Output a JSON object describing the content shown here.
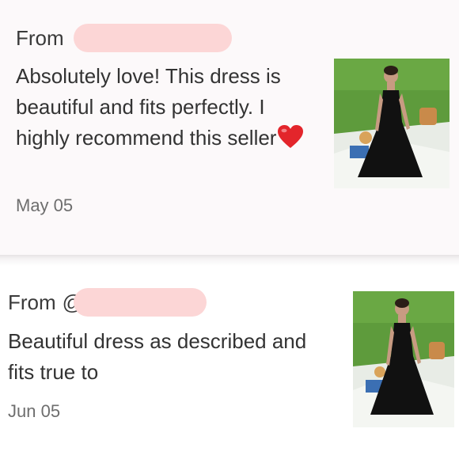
{
  "reviews": [
    {
      "from_label": "From",
      "body": "Absolutely love! This dress is beautiful and fits perfectly. I highly recommend this seller",
      "emoji": "red-heart",
      "date": "May 05",
      "image_icon": "dress-photo"
    },
    {
      "from_label": "From",
      "handle_prefix": "@",
      "body": "Beautiful dress as described and fits true to",
      "date": "Jun 05",
      "image_icon": "dress-photo"
    }
  ],
  "colors": {
    "redaction": "#fcd6d6",
    "card_bg": "#fcf9fa",
    "heart": "#e3252b",
    "dress": "#111111",
    "grass": "#5e9b3c"
  }
}
